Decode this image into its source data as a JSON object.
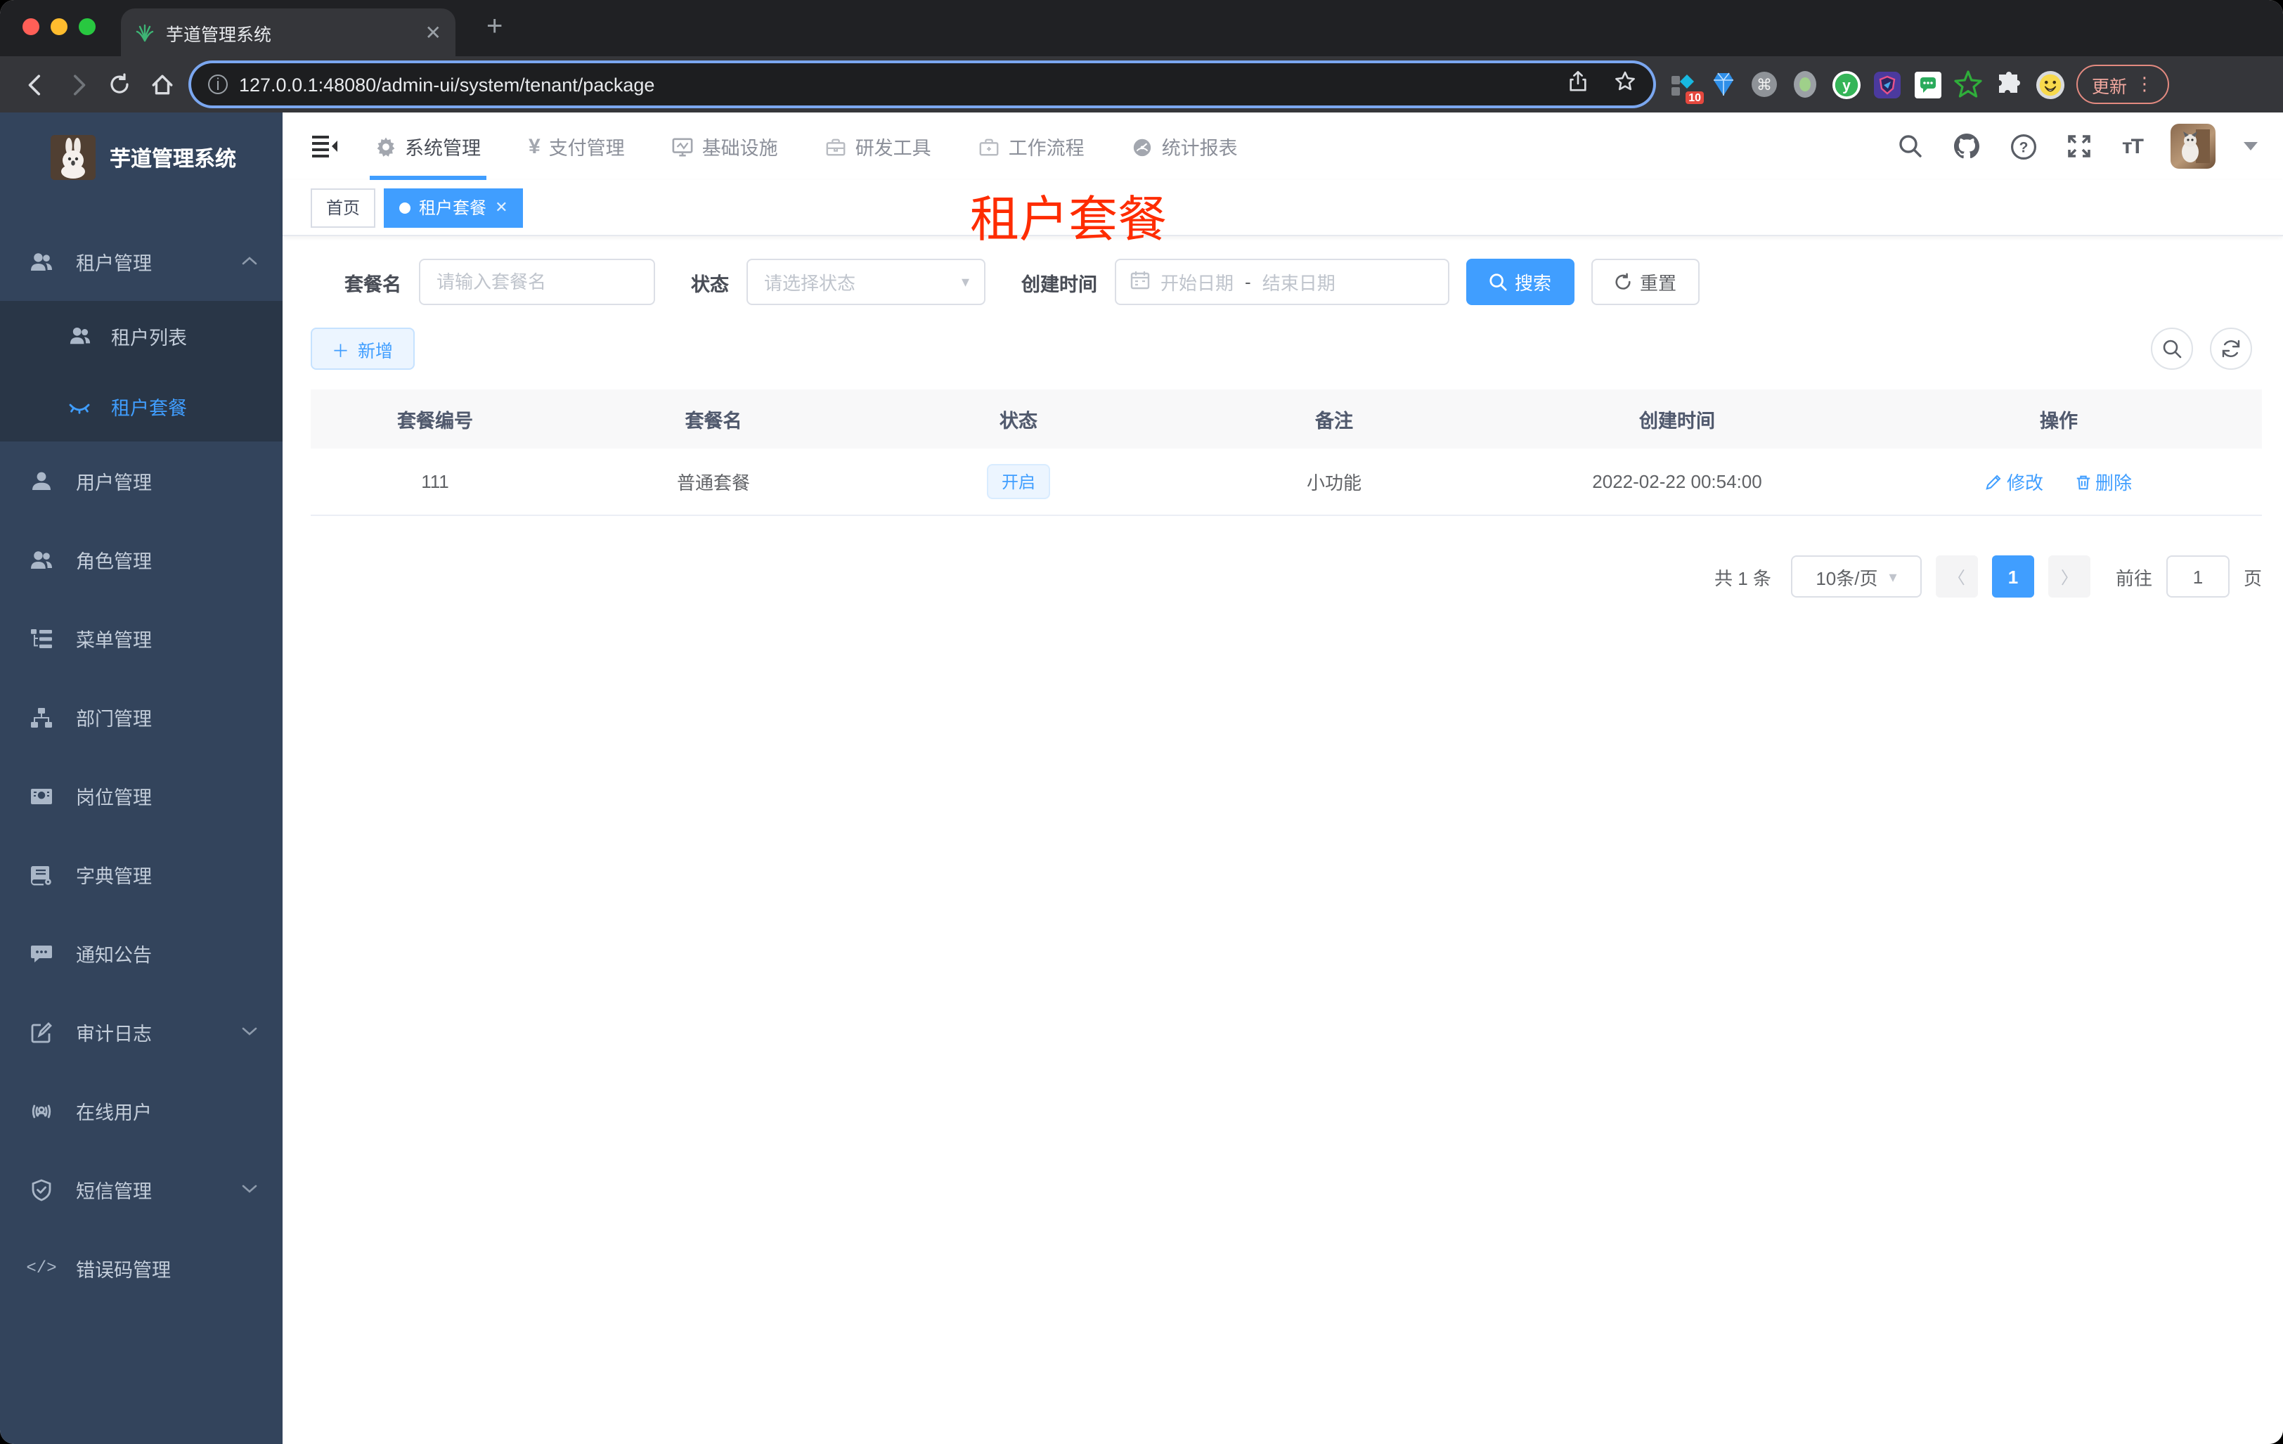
{
  "browser": {
    "tab_title": "芋道管理系统",
    "url": "127.0.0.1:48080/admin-ui/system/tenant/package",
    "update_label": "更新",
    "ext_badge": "10"
  },
  "sidebar": {
    "logo_title": "芋道管理系统",
    "menu": [
      {
        "label": "租户管理"
      },
      {
        "label": "租户列表"
      },
      {
        "label": "租户套餐"
      },
      {
        "label": "用户管理"
      },
      {
        "label": "角色管理"
      },
      {
        "label": "菜单管理"
      },
      {
        "label": "部门管理"
      },
      {
        "label": "岗位管理"
      },
      {
        "label": "字典管理"
      },
      {
        "label": "通知公告"
      },
      {
        "label": "审计日志"
      },
      {
        "label": "在线用户"
      },
      {
        "label": "短信管理"
      },
      {
        "label": "错误码管理"
      }
    ]
  },
  "header": {
    "nav": [
      {
        "label": "系统管理"
      },
      {
        "label": "支付管理"
      },
      {
        "label": "基础设施"
      },
      {
        "label": "研发工具"
      },
      {
        "label": "工作流程"
      },
      {
        "label": "统计报表"
      }
    ],
    "yen": "¥",
    "font_tool": "тT"
  },
  "tags": {
    "home": "首页",
    "current": "租户套餐"
  },
  "watermark": "租户套餐",
  "filters": {
    "name_label": "套餐名",
    "name_placeholder": "请输入套餐名",
    "status_label": "状态",
    "status_placeholder": "请选择状态",
    "date_label": "创建时间",
    "date_start": "开始日期",
    "date_sep": "-",
    "date_end": "结束日期",
    "search": "搜索",
    "reset": "重置"
  },
  "toolbar": {
    "add": "新增"
  },
  "table": {
    "headers": [
      "套餐编号",
      "套餐名",
      "状态",
      "备注",
      "创建时间",
      "操作"
    ],
    "rows": [
      {
        "id": "111",
        "name": "普通套餐",
        "status": "开启",
        "remark": "小功能",
        "created": "2022-02-22 00:54:00"
      }
    ],
    "actions": {
      "edit": "修改",
      "del": "删除"
    }
  },
  "pagination": {
    "total": "共 1 条",
    "size": "10条/页",
    "page": "1",
    "goto": "前往",
    "value": "1",
    "unit": "页"
  },
  "colors": {
    "accent": "#409eff",
    "watermark_red": "#fe2c00",
    "sidebar_bg": "#33445c"
  },
  "code_icon": "</>"
}
